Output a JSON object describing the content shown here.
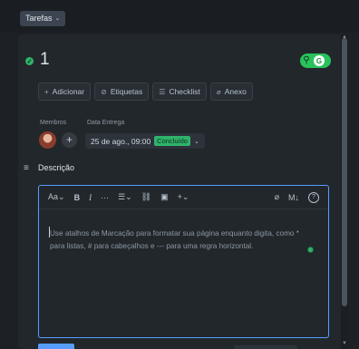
{
  "header": {
    "board_button_label": "Tarefas",
    "board_caret": "⌄"
  },
  "card": {
    "title": "1",
    "status_check": "✓",
    "power_up_badge": {
      "pin_icon": "map-pin",
      "letter": "G",
      "color": "#28c25b"
    },
    "actions": [
      {
        "icon": "+",
        "label": "Adicionar"
      },
      {
        "icon": "⊘",
        "label": "Etiquetas"
      },
      {
        "icon": "☰",
        "label": "Checklist"
      },
      {
        "icon": "⌀",
        "label": "Anexo"
      }
    ],
    "members_label": "Membros",
    "add_member": "+",
    "due_label": "Data Entrega",
    "due_value": "25 de ago., 09:00",
    "due_status": "Concluído",
    "due_caret": "⌄",
    "description_icon": "≡",
    "description_title": "Descrição"
  },
  "editor": {
    "toolbar": {
      "text_style": "Aa⌄",
      "bold": "B",
      "italic": "I",
      "more": "···",
      "list": "☰⌄",
      "link": "⛓",
      "image": "▣",
      "insert": "+⌄",
      "attach": "⌀",
      "markdown": "M↓",
      "help": "?"
    },
    "placeholder": "Use atalhos de Marcação para formatar sua página enquanto digita, como * para listas, # para cabeçalhos e --- para uma regra horizontal."
  },
  "colors": {
    "background": "#1d2125",
    "card": "#22272b",
    "accent": "#579dff",
    "success": "#2fb36b"
  }
}
